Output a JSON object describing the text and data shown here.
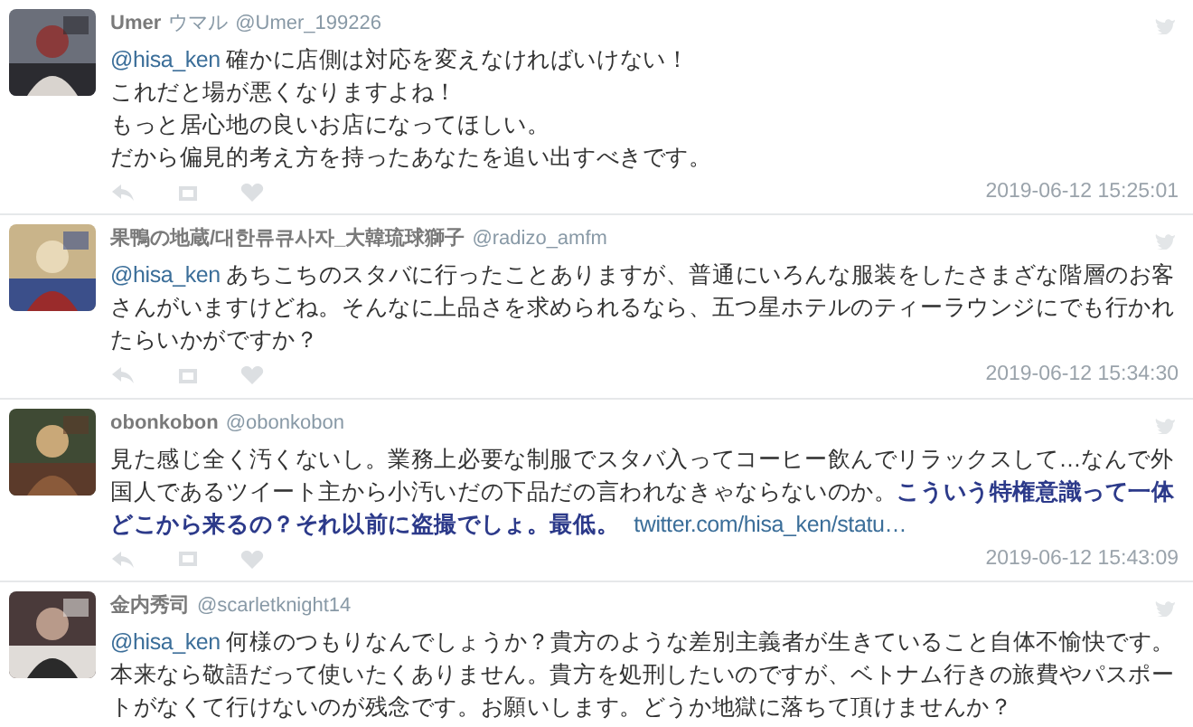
{
  "tweets": [
    {
      "name": "Umer",
      "display": "ウマル",
      "handle": "@Umer_199226",
      "avatar": {
        "kind": "picture"
      },
      "paragraphs": [
        [
          {
            "kind": "mention",
            "text": "@hisa_ken"
          },
          {
            "kind": "text",
            "text": " 確かに店側は対応を変えなければいけない！"
          }
        ],
        [
          {
            "kind": "text",
            "text": "これだと場が悪くなりますよね！"
          }
        ],
        [
          {
            "kind": "text",
            "text": "もっと居心地の良いお店になってほしい。"
          }
        ],
        [
          {
            "kind": "text",
            "text": "だから偏見的考え方を持ったあなたを追い出すべきです。"
          }
        ]
      ],
      "timestamp": "2019-06-12 15:25:01"
    },
    {
      "name": "果鴨の地蔵/대한류큐사자_大韓琉球獅子",
      "handle": "@radizo_amfm",
      "avatar": {
        "kind": "picture"
      },
      "paragraphs": [
        [
          {
            "kind": "mention",
            "text": "@hisa_ken"
          },
          {
            "kind": "text",
            "text": " あちこちのスタバに行ったことありますが、普通にいろんな服装をしたさまざな階層のお客さんがいますけどね。そんなに上品さを求められるなら、五つ星ホテルのティーラウンジにでも行かれたらいかがですか？"
          }
        ]
      ],
      "timestamp": "2019-06-12 15:34:30"
    },
    {
      "name": "obonkobon",
      "handle": "@obonkobon",
      "avatar": {
        "kind": "picture"
      },
      "paragraphs": [
        [
          {
            "kind": "text",
            "text": "見た感じ全く汚くないし。業務上必要な制服でスタバ入ってコーヒー飲んでリラックスして…なんで外国人であるツイート主から小汚いだの下品だの言われなきゃならないのか。"
          },
          {
            "kind": "emphasis",
            "text": "こういう特権意識って一体どこから来るの？それ以前に盗撮でしょ。最低。"
          },
          {
            "kind": "link",
            "text": "twitter.com/hisa_ken/statu…"
          }
        ]
      ],
      "timestamp": "2019-06-12 15:43:09"
    },
    {
      "name": "金内秀司",
      "handle": "@scarletknight14",
      "avatar": {
        "kind": "picture"
      },
      "paragraphs": [
        [
          {
            "kind": "mention",
            "text": "@hisa_ken"
          },
          {
            "kind": "text",
            "text": " 何様のつもりなんでしょうか？貴方のような差別主義者が生きていること自体不愉快です。本来なら敬語だって使いたくありません。貴方を処刑したいのですが、ベトナム行きの旅費やパスポートがなくて行けないのが残念です。お願いします。どうか地獄に落ちて頂けませんか？"
          }
        ]
      ]
    }
  ]
}
